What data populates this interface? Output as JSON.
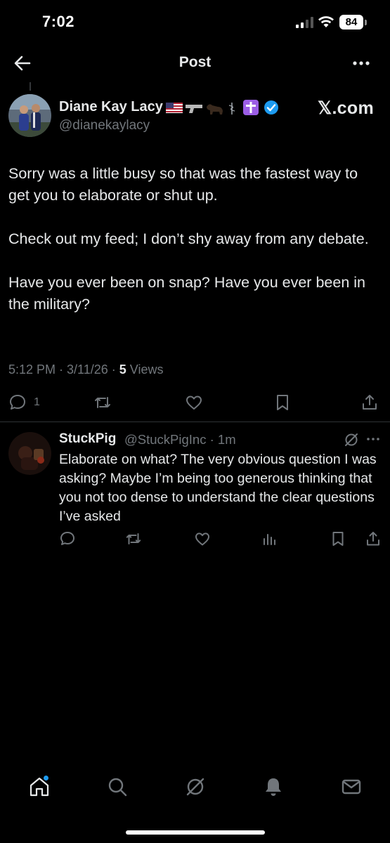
{
  "status": {
    "time": "7:02",
    "battery": "84"
  },
  "nav": {
    "title": "Post"
  },
  "post": {
    "author_name": "Diane Kay Lacy",
    "author_handle": "@dianekaylacy",
    "watermark": "𝕏.com",
    "paragraphs": [
      "Sorry was a little busy so that was the fastest way to get you to elaborate or shut up.",
      "Check out my feed; I don’t shy away from any debate.",
      "Have you ever been on snap? Have you ever been in the military?"
    ],
    "timestamp": "5:12 PM · 3/11/26 · ",
    "views_count": "5",
    "views_label": " Views",
    "reply_count": "1"
  },
  "reply": {
    "name": "StuckPig",
    "handle_time": "@StuckPigInc · 1m",
    "text": "Elaborate on what? The very obvious question I was asking? Maybe I’m being too generous thinking that you not too dense to understand the clear questions I’ve asked"
  },
  "icons": {
    "back": "arrow-left-icon",
    "more": "more-horizontal-icon",
    "verified": "verified-badge-icon",
    "reply": "comment-icon",
    "retweet": "repost-icon",
    "like": "heart-icon",
    "bookmark": "bookmark-icon",
    "share": "share-icon",
    "views": "views-chart-icon",
    "grok": "grok-icon",
    "home": "home-icon",
    "search": "search-icon",
    "notifications": "bell-icon",
    "messages": "mail-icon"
  },
  "colors": {
    "background": "#000000",
    "text": "#e7e9ea",
    "muted": "#71767b",
    "accent": "#1d9bf0",
    "divider": "#2f3336"
  }
}
